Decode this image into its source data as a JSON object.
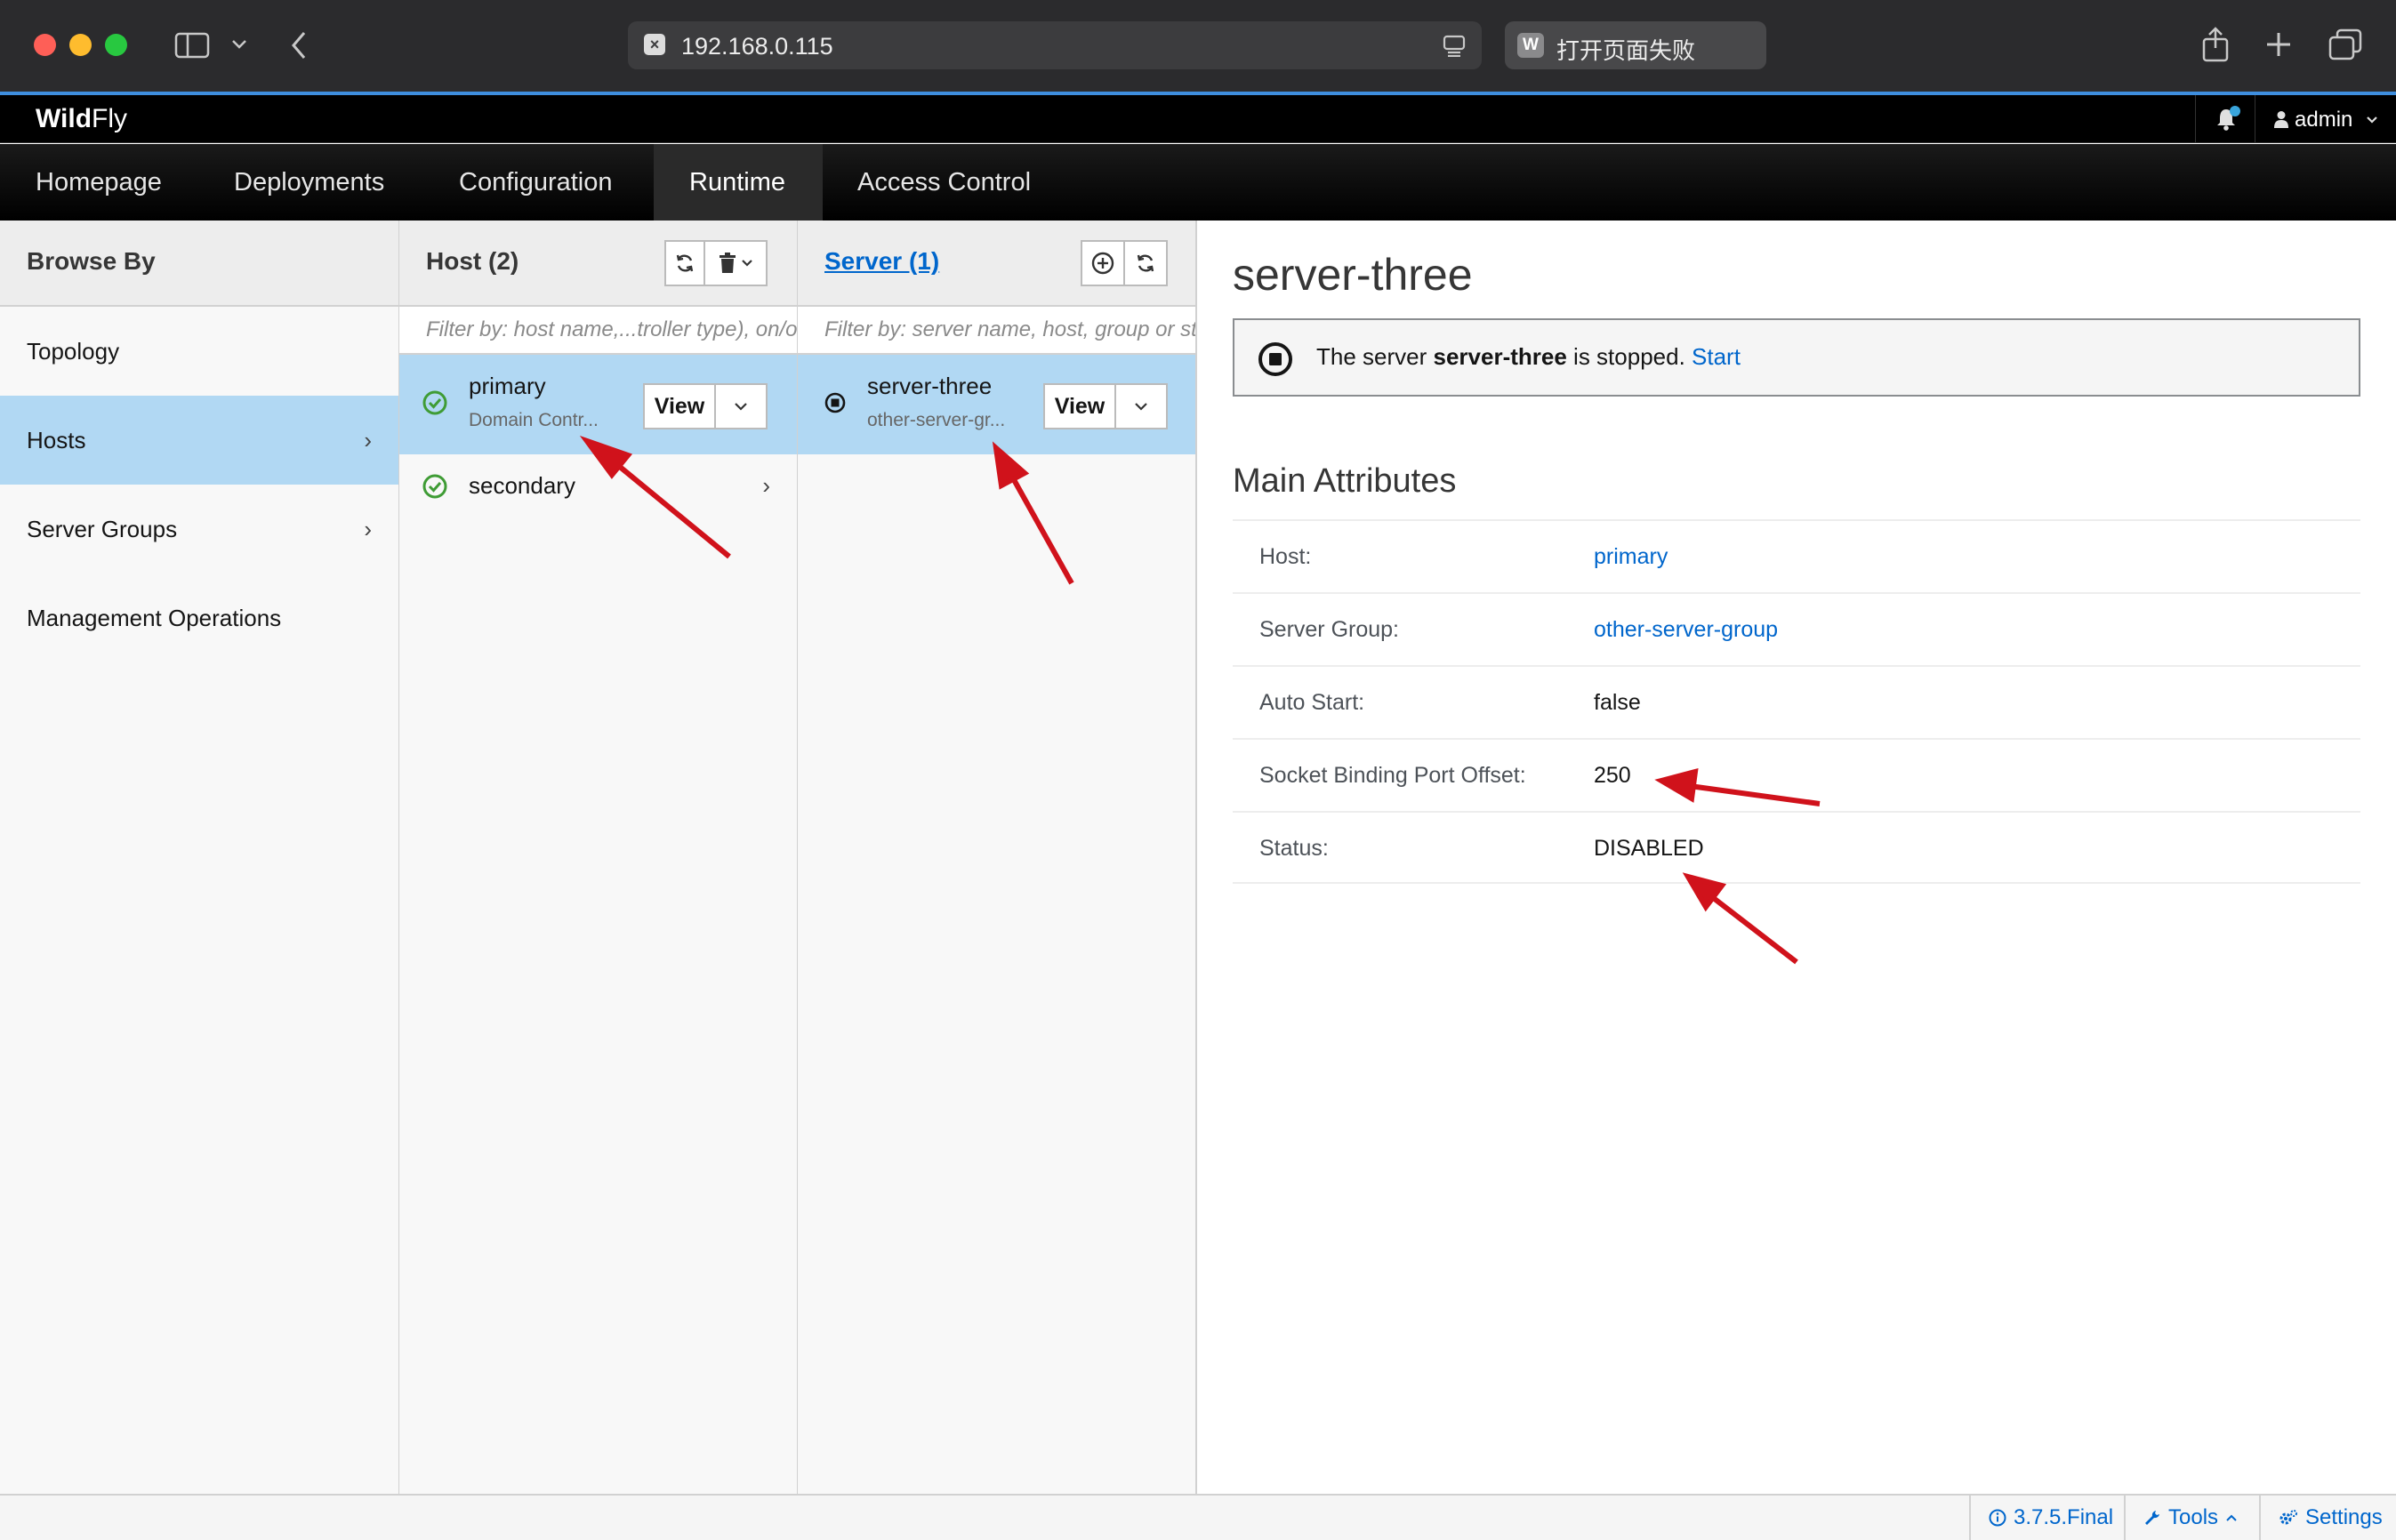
{
  "browser": {
    "address": "192.168.0.115",
    "tab_title": "打开页面失败",
    "tab_favicon_letter": "W"
  },
  "app": {
    "brand_bold": "Wild",
    "brand_light": "Fly",
    "user": "admin"
  },
  "nav": {
    "items": [
      "Homepage",
      "Deployments",
      "Configuration",
      "Runtime",
      "Access Control"
    ],
    "active": "Runtime"
  },
  "browse": {
    "title": "Browse By",
    "items": [
      "Topology",
      "Hosts",
      "Server Groups",
      "Management Operations"
    ],
    "selected": "Hosts"
  },
  "hosts": {
    "title": "Host (2)",
    "filter_placeholder": "Filter by: host name,...troller type), on/off",
    "items": [
      {
        "name": "primary",
        "subtitle": "Domain Contr...",
        "status": "ok"
      },
      {
        "name": "secondary",
        "subtitle": "",
        "status": "ok"
      }
    ],
    "view_label": "View"
  },
  "servers": {
    "title": "Server (1)",
    "filter_placeholder": "Filter by: server name, host, group or status",
    "items": [
      {
        "name": "server-three",
        "subtitle": "other-server-gr...",
        "status": "stopped"
      }
    ],
    "view_label": "View"
  },
  "detail": {
    "title": "server-three",
    "alert_prefix": "The server",
    "alert_server": "server-three",
    "alert_suffix": "is stopped.",
    "alert_action": "Start",
    "section_title": "Main Attributes",
    "attributes": [
      {
        "label": "Host:",
        "value": "primary",
        "link": true
      },
      {
        "label": "Server Group:",
        "value": "other-server-group",
        "link": true
      },
      {
        "label": "Auto Start:",
        "value": "false",
        "link": false
      },
      {
        "label": "Socket Binding Port Offset:",
        "value": "250",
        "link": false
      },
      {
        "label": "Status:",
        "value": "DISABLED",
        "link": false
      }
    ]
  },
  "footer": {
    "version": "3.7.5.Final",
    "tools": "Tools",
    "settings": "Settings"
  },
  "colors": {
    "selection": "#b1d8f3",
    "link": "#0066cc",
    "ok_green": "#3f9c35",
    "annotation_red": "#d0121b"
  }
}
